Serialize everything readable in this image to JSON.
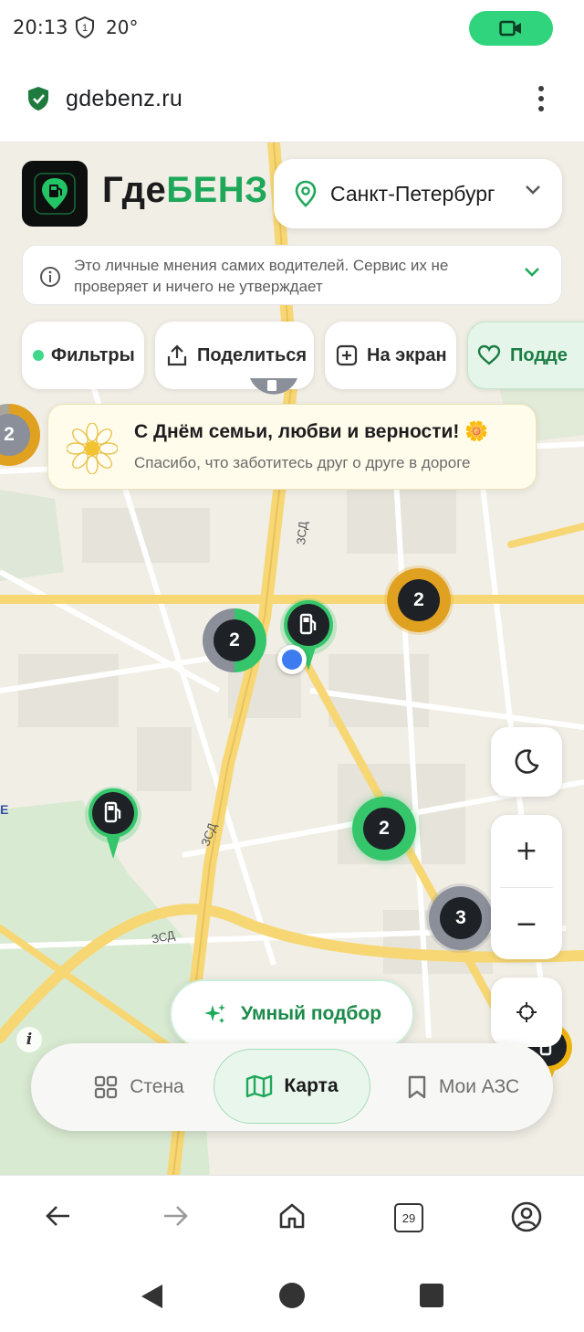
{
  "status_bar": {
    "time": "20:13",
    "temperature": "20°"
  },
  "browser": {
    "url": "gdebenz.ru",
    "tabs_count": "29"
  },
  "header": {
    "brand_part1": "Где",
    "brand_part2": "БЕНЗ",
    "city": "Санкт-Петербург"
  },
  "notice": {
    "text": "Это личные мнения самих водителей. Сервис их не проверяет и ничего не утверждает"
  },
  "chips": {
    "filters": "Фильтры",
    "share": "Поделиться",
    "to_screen": "На экран",
    "support": "Подде"
  },
  "banner": {
    "title": "С Днём семьи, любви и верности! 🌼",
    "subtitle": "Спасибо, что заботитесь друг о друге в дороге"
  },
  "map": {
    "road_labels": [
      "ЗСД",
      "ЗСД",
      "ЗСД"
    ],
    "clusters": [
      {
        "count": "2",
        "color": "#e0a020"
      },
      {
        "count": "2",
        "color": "#e0a020"
      },
      {
        "count": "2",
        "color": "#8a8f99"
      },
      {
        "count": "2",
        "color": "#35c66b"
      },
      {
        "count": "3",
        "color": "#8a8f99"
      }
    ],
    "edge_letter": "E",
    "attribution": "i"
  },
  "controls": {
    "zoom_in": "+",
    "zoom_out": "−"
  },
  "smart_pick": "Умный подбор",
  "bottom_nav": {
    "wall": "Стена",
    "map": "Карта",
    "my_stations": "Мои АЗС"
  },
  "colors": {
    "brand_green": "#1fa85a",
    "accent_green": "#35c66b",
    "orange": "#e0a020"
  }
}
